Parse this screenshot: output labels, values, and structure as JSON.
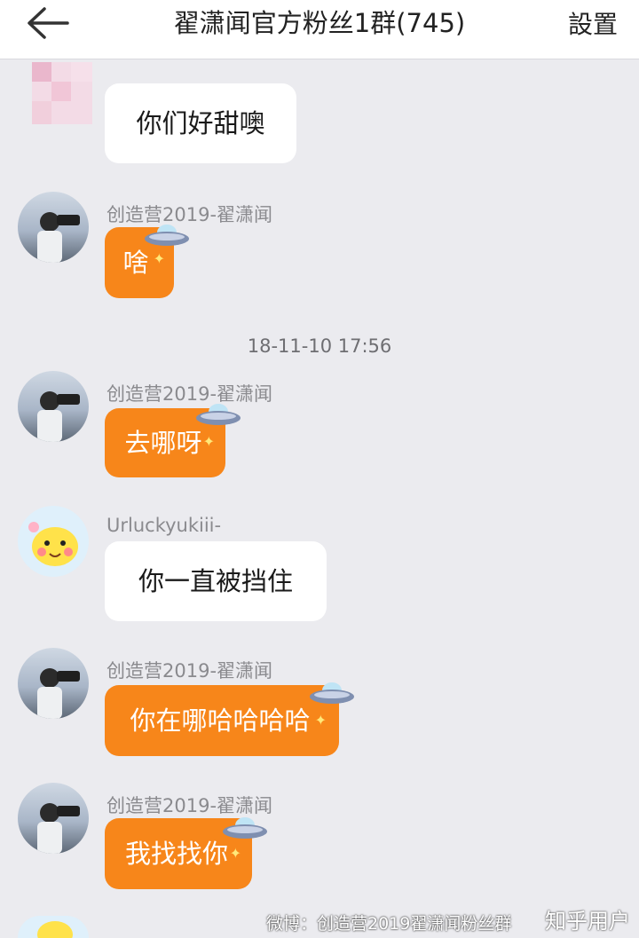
{
  "header": {
    "title": "翟潇闻官方粉丝1群(745)",
    "settings_label": "設置"
  },
  "messages": [
    {
      "text": "你们好甜噢"
    },
    {
      "sender": "创造营2019-翟潇闻",
      "text": "啥"
    },
    {
      "sender": "创造营2019-翟潇闻",
      "text": "去哪呀"
    },
    {
      "sender": "Urluckyukiii-",
      "text": "你一直被挡住"
    },
    {
      "sender": "创造营2019-翟潇闻",
      "text": "你在哪哈哈哈哈"
    },
    {
      "sender": "创造营2019-翟潇闻",
      "text": "我找找你"
    }
  ],
  "timestamp": "18-11-10 17:56",
  "footer": {
    "watermark": "微博：创造营2019翟潇闻粉丝群",
    "zhihu": "知乎用户"
  },
  "colors": {
    "background": "#ebebef",
    "bubble_orange": "#f7861a",
    "bubble_white": "#ffffff"
  }
}
